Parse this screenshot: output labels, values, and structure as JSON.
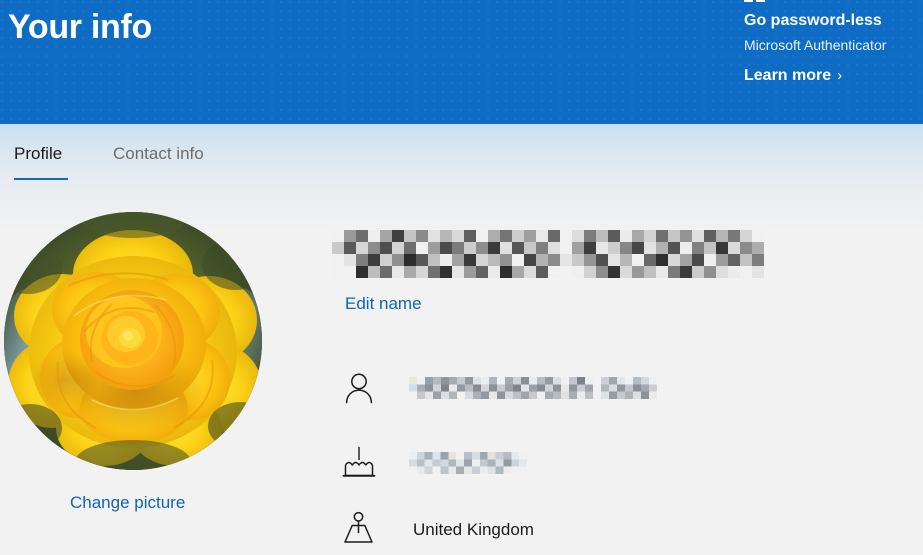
{
  "header": {
    "title": "Your info",
    "background_color": "#0e6cc4",
    "promo": {
      "icon": "authenticator-app-icon",
      "title": "Go password-less",
      "subtitle": "Microsoft Authenticator",
      "link_label": "Learn more",
      "link_chevron": "›"
    }
  },
  "tabs": [
    {
      "id": "profile",
      "label": "Profile",
      "selected": true,
      "accent_color": "#0f6cbd"
    },
    {
      "id": "contact-info",
      "label": "Contact info",
      "selected": false
    }
  ],
  "profile": {
    "avatar": {
      "icon": "profile-photo-yellow-rose",
      "description": "Yellow rose photograph",
      "shape": "circle"
    },
    "change_picture_label": "Change picture",
    "name": {
      "value": "",
      "redacted": true
    },
    "edit_name_label": "Edit name",
    "link_color": "#0f63b5",
    "rows": [
      {
        "id": "account",
        "icon": "person-icon",
        "value": "",
        "redacted": true
      },
      {
        "id": "birthday",
        "icon": "birthday-cake-icon",
        "value": "",
        "redacted": true
      },
      {
        "id": "country",
        "icon": "location-pin-icon",
        "value": "United Kingdom",
        "redacted": false
      }
    ]
  }
}
